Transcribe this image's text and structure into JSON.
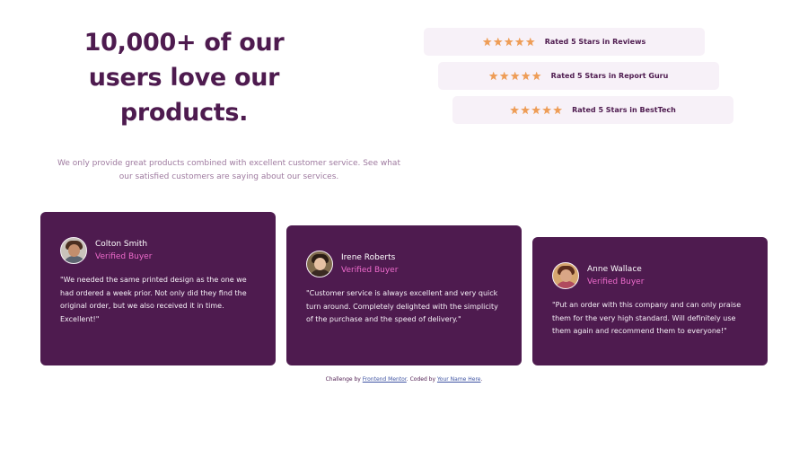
{
  "hero": {
    "title_line1": "10,000+ of our",
    "title_line2": "users love our",
    "title_line3": "products.",
    "description": "We only provide great products combined with excellent customer service. See what our satisfied customers are saying about our services."
  },
  "ratings": [
    {
      "label": "Rated 5 Stars in Reviews",
      "stars": 5
    },
    {
      "label": "Rated 5 Stars in Report Guru",
      "stars": 5
    },
    {
      "label": "Rated 5 Stars in BestTech",
      "stars": 5
    }
  ],
  "testimonials": [
    {
      "name": "Colton Smith",
      "badge": "Verified Buyer",
      "quote": "\"We needed the same printed design as the one we had ordered a week prior. Not only did they find the original order, but we also received it in time. Excellent!\""
    },
    {
      "name": "Irene Roberts",
      "badge": "Verified Buyer",
      "quote": "\"Customer service is always excellent and very quick turn around. Completely delighted with the simplicity of the purchase and the speed of delivery.\""
    },
    {
      "name": "Anne Wallace",
      "badge": "Verified Buyer",
      "quote": "\"Put an order with this company and can only praise them for the very high standard. Will definitely use them again and recommend them to everyone!\""
    }
  ],
  "footer": {
    "prefix": "Challenge by",
    "link1": "Frontend Mentor",
    "middle": ". Coded by",
    "link2": "Your Name Here",
    "suffix": "."
  },
  "colors": {
    "primary": "#4e1b4f",
    "accent_pink": "#ee6bcc",
    "star": "#ee9d57",
    "rating_bg": "#f7f1f8"
  },
  "icons": {
    "star": "star-icon"
  }
}
